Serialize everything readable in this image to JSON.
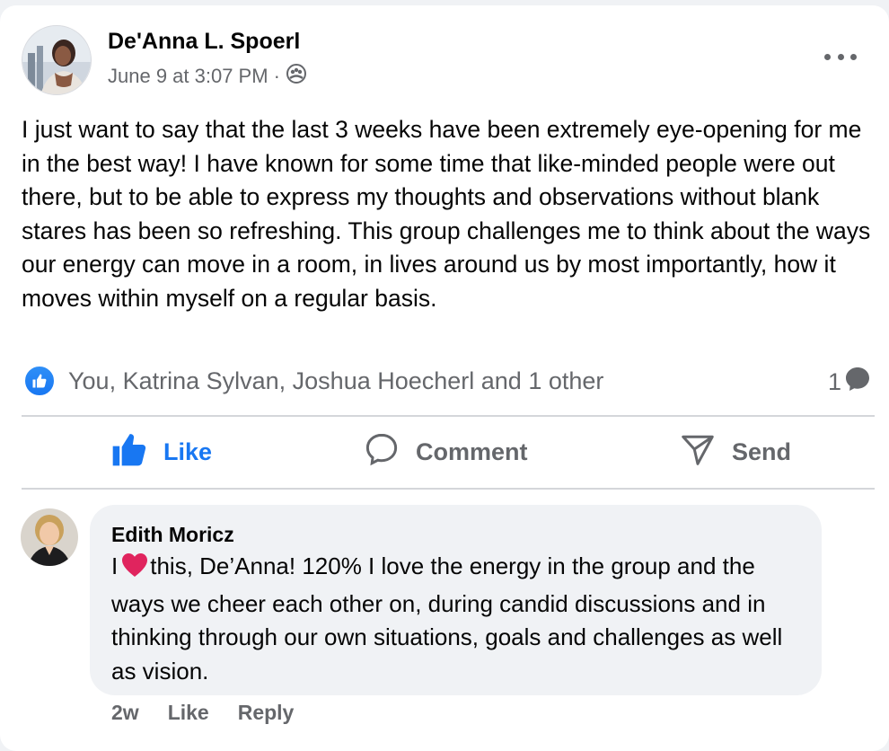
{
  "post": {
    "author": "De'Anna L. Spoerl",
    "timestamp": "June 9 at 3:07 PM",
    "separator": "·",
    "audience_icon": "group-audience-icon",
    "more_icon": "more-horizontal-icon",
    "text": "I just want to say that the last 3 weeks have been extremely eye-opening for me in the best way! I have known for some time that like-minded people were out there, but to be able to express my thoughts and observations without blank stares has been so refreshing. This group challenges me to think about the ways our energy can move in a room, in lives around us by most importantly, how it moves within myself on a regular basis.",
    "reactions_summary": "You, Katrina Sylvan, Joshua Hoecherl and 1 other",
    "comment_count": "1"
  },
  "actions": {
    "like_label": "Like",
    "comment_label": "Comment",
    "send_label": "Send"
  },
  "comment": {
    "author": "Edith Moricz",
    "text_before_heart": "I",
    "text_after_heart": "this, De’Anna! 120% I love the energy in the group and the ways we cheer each other on, during candid discussions and in thinking through our own situations, goals and challenges as well as vision.",
    "age": "2w",
    "like_label": "Like",
    "reply_label": "Reply"
  },
  "colors": {
    "accent": "#1877f2",
    "secondary_text": "#65676b",
    "bubble_bg": "#f0f2f5",
    "heart": "#e0245e"
  }
}
